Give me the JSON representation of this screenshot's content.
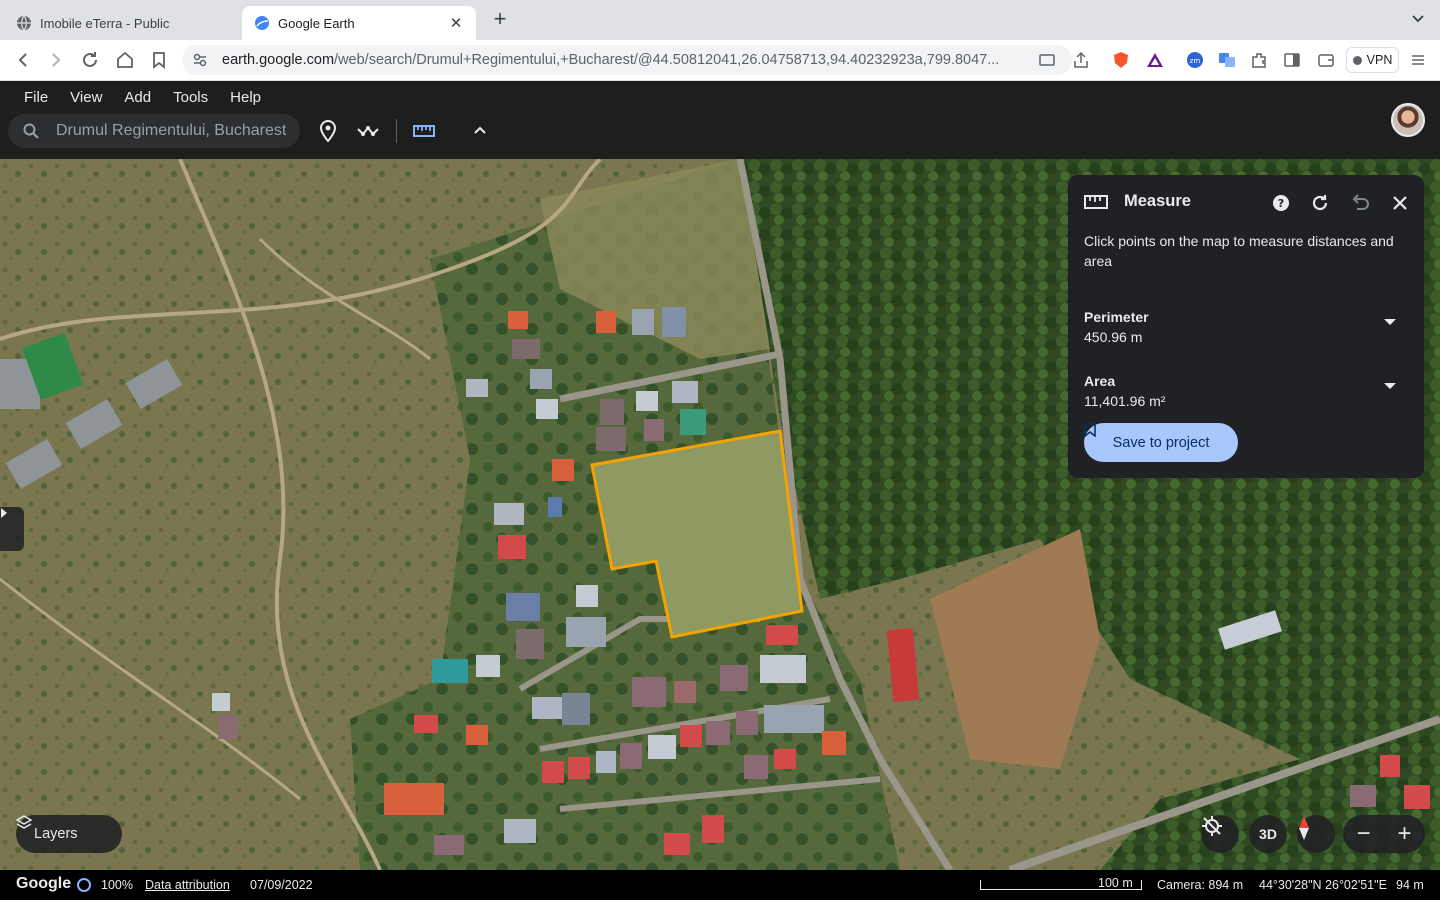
{
  "browser": {
    "tabs": [
      {
        "title": "Imobile eTerra - Public",
        "favicon": "globe-icon"
      },
      {
        "title": "Google Earth",
        "favicon": "google-earth-icon",
        "active": true
      }
    ],
    "url_host": "earth.google.com",
    "url_path": "/web/search/Drumul+Regimentului,+Bucharest/@44.50812041,26.04758713,94.40232923a,799.8047...",
    "vpn_label": "VPN"
  },
  "menu": {
    "items": [
      "File",
      "View",
      "Add",
      "Tools",
      "Help"
    ]
  },
  "search": {
    "value": "Drumul Regimentului, Bucharest"
  },
  "measure": {
    "title": "Measure",
    "hint": "Click points on the map to measure distances and area",
    "perimeter_label": "Perimeter",
    "perimeter_value": "450.96 m",
    "area_label": "Area",
    "area_value": "11,401.96 m²",
    "save_label": "Save to project",
    "outline_color": "#f5a300"
  },
  "controls": {
    "layers_label": "Layers",
    "view_3d_label": "3D"
  },
  "status": {
    "google_label": "Google",
    "load_percent": "100%",
    "attribution_label": "Data attribution",
    "imagery_date": "07/09/2022",
    "scale_label": "100 m",
    "camera": "Camera: 894 m",
    "coordinates": "44°30'28\"N 26°02'51\"E",
    "elevation": "94 m"
  }
}
